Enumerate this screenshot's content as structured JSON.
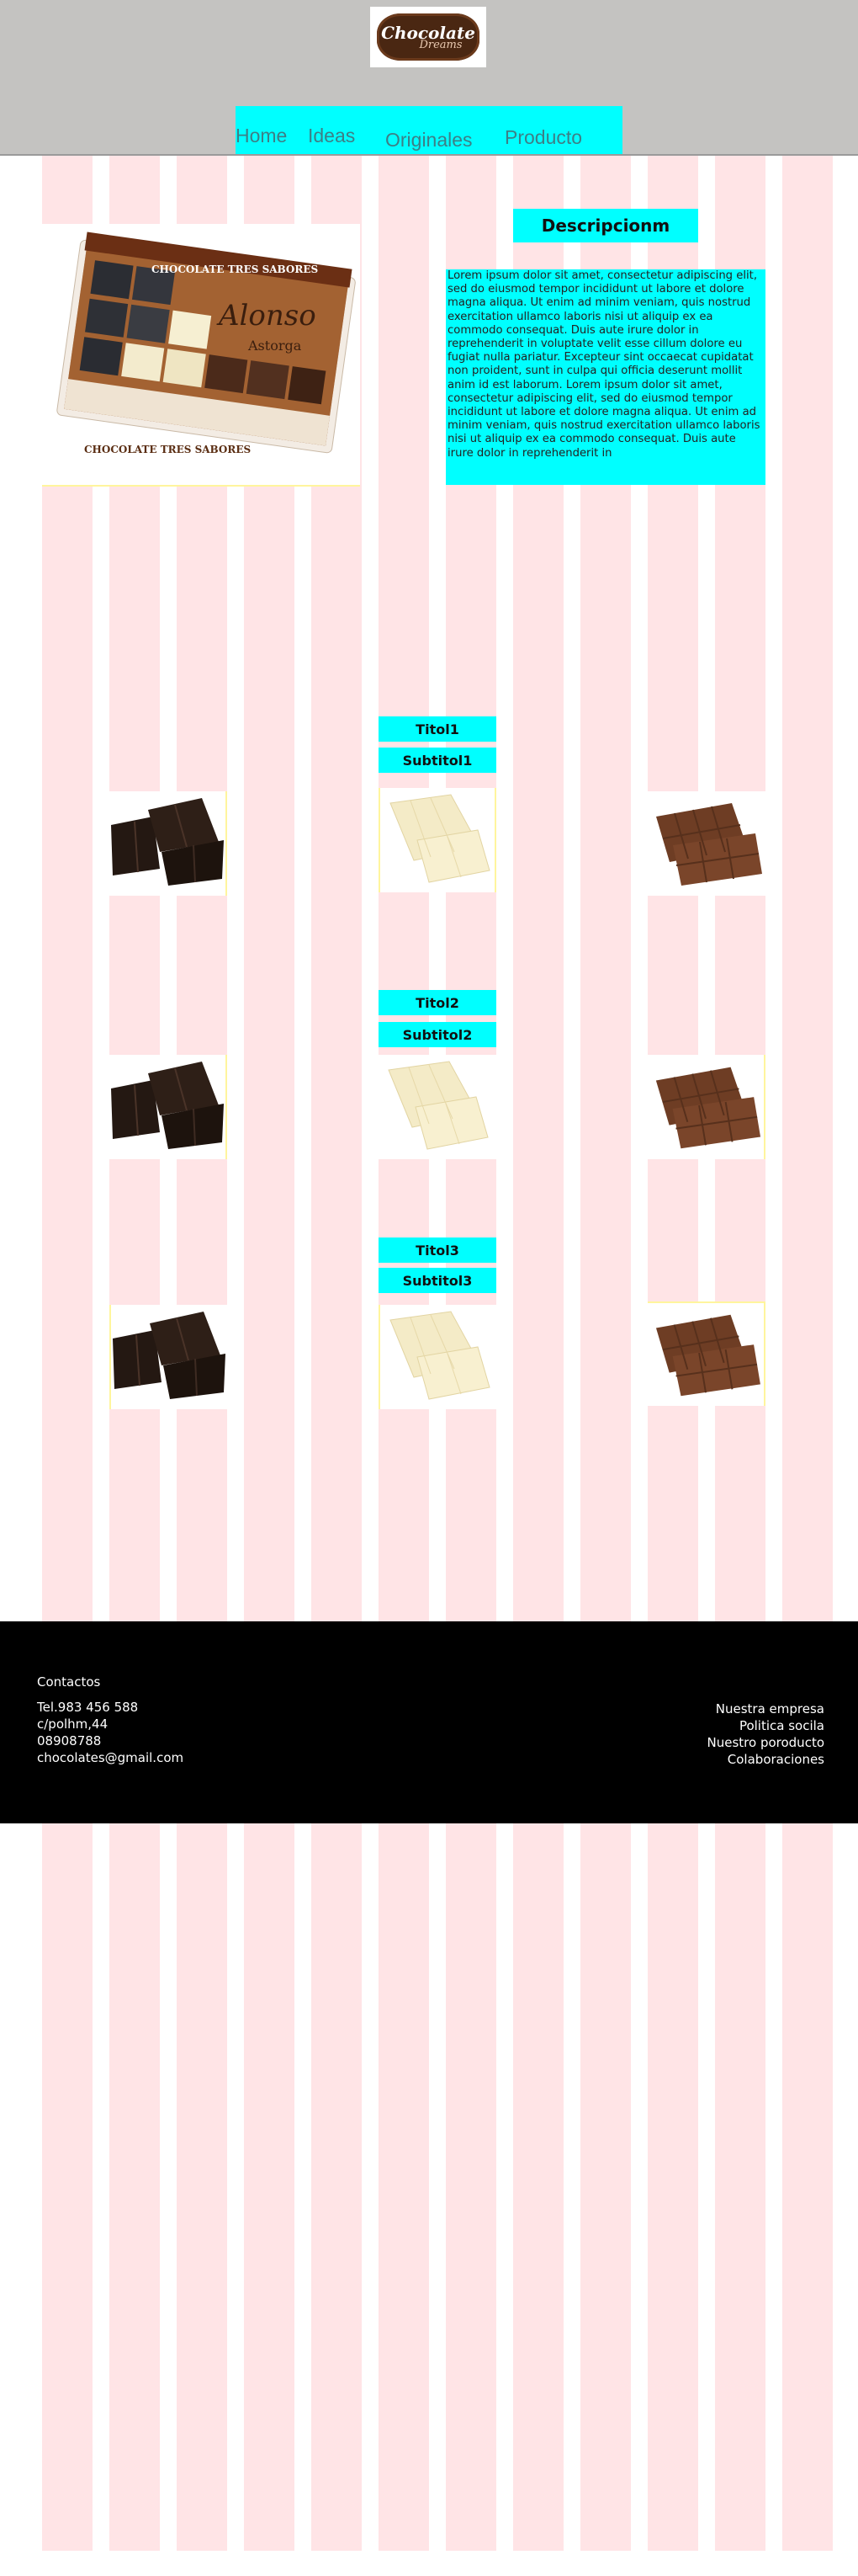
{
  "brand": {
    "logo_text_top": "Chocolate",
    "logo_text_bottom": "Dreams",
    "colors": {
      "header_bg": "#c4c3c1",
      "accent": "#00ffff",
      "column_pink": "#ffe4e6",
      "footer_bg": "#000000"
    }
  },
  "nav": {
    "items": [
      {
        "label": "Home"
      },
      {
        "label": "Ideas"
      },
      {
        "label": "Originales"
      },
      {
        "label": "Producto"
      }
    ]
  },
  "hero": {
    "image_name": "chocolate-tres-sabores-box",
    "box_brand": "Alonso",
    "box_city": "Astorga",
    "box_caption": "CHOCOLATE TRES SABORES"
  },
  "description": {
    "title": "Descripcionm",
    "body": "Lorem ipsum dolor sit amet, consectetur adipiscing elit, sed do eiusmod tempor incididunt ut labore et dolore magna aliqua. Ut enim ad minim veniam, quis nostrud exercitation ullamco laboris nisi ut aliquip ex ea commodo consequat. Duis aute irure dolor in reprehenderit in voluptate velit esse cillum dolore eu fugiat nulla pariatur. Excepteur sint occaecat cupidatat non proident, sunt in culpa qui officia deserunt mollit anim id est laborum. Lorem ipsum dolor sit amet, consectetur adipiscing elit, sed do eiusmod tempor incididunt ut labore et dolore magna aliqua. Ut enim ad minim veniam, quis nostrud exercitation ullamco laboris nisi ut aliquip ex ea commodo consequat. Duis aute irure dolor in reprehenderit in"
  },
  "sections": [
    {
      "title": "Titol1",
      "subtitle": "Subtitol1",
      "products": [
        "dark-chocolate-pieces",
        "white-chocolate-bar",
        "milk-chocolate-bars"
      ]
    },
    {
      "title": "Titol2",
      "subtitle": "Subtitol2",
      "products": [
        "dark-chocolate-pieces",
        "white-chocolate-bar",
        "milk-chocolate-bars"
      ]
    },
    {
      "title": "Titol3",
      "subtitle": "Subtitol3",
      "products": [
        "dark-chocolate-pieces",
        "white-chocolate-bar",
        "milk-chocolate-bars"
      ]
    }
  ],
  "footer": {
    "heading": "Contactos",
    "phone": "Tel.983 456 588",
    "address": "c/polhm,44",
    "postal": "08908788",
    "email": "chocolates@gmail.com",
    "links": [
      {
        "label": "Nuestra empresa"
      },
      {
        "label": "Politica socila"
      },
      {
        "label": "Nuestro poroducto"
      },
      {
        "label": "Colaboraciones"
      }
    ]
  }
}
